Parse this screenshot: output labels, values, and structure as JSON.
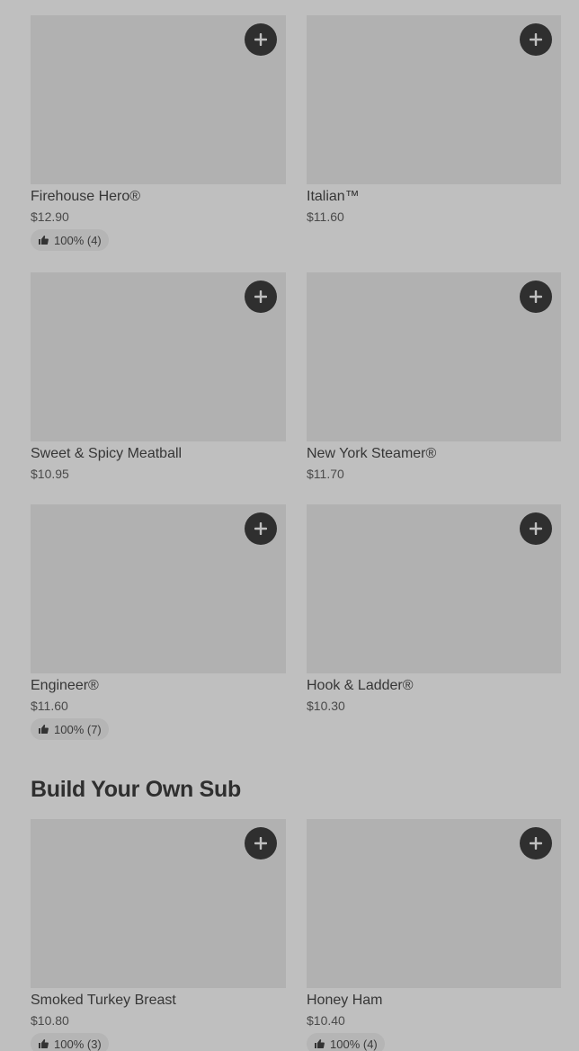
{
  "menu_items": [
    {
      "name": "Firehouse Hero®",
      "price": "$12.90",
      "rating": "100% (4)"
    },
    {
      "name": "Italian™",
      "price": "$11.60",
      "rating": null
    },
    {
      "name": "Sweet & Spicy Meatball",
      "price": "$10.95",
      "rating": null
    },
    {
      "name": "New York Steamer®",
      "price": "$11.70",
      "rating": null
    },
    {
      "name": "Engineer®",
      "price": "$11.60",
      "rating": "100% (7)"
    },
    {
      "name": "Hook & Ladder®",
      "price": "$10.30",
      "rating": null
    }
  ],
  "build_your_own": {
    "title": "Build Your Own Sub",
    "items": [
      {
        "name": "Smoked Turkey Breast",
        "price": "$10.80",
        "rating": "100% (3)"
      },
      {
        "name": "Honey Ham",
        "price": "$10.40",
        "rating": "100% (4)"
      }
    ]
  },
  "icons": {
    "add": "plus-icon",
    "rating": "thumbs-up-icon"
  },
  "colors": {
    "background": "#bfbfbf",
    "image_placeholder": "#b1b1b1",
    "add_button": "#2f2f2f",
    "rating_badge": "#b5b5b5"
  }
}
